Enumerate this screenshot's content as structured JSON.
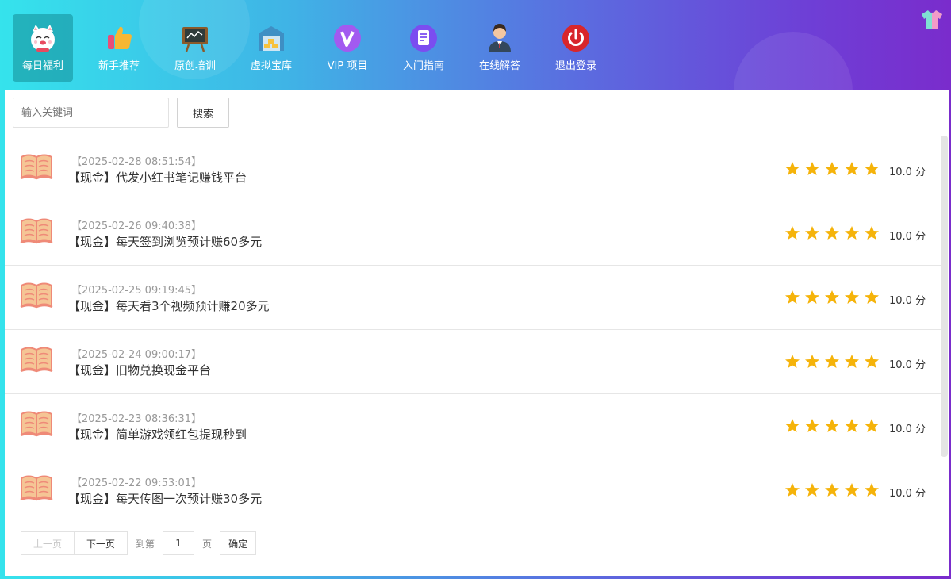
{
  "nav": {
    "items": [
      {
        "label": "每日福利",
        "icon": "lucky-cat-icon"
      },
      {
        "label": "新手推荐",
        "icon": "thumbs-up-icon"
      },
      {
        "label": "原创培训",
        "icon": "chalkboard-icon"
      },
      {
        "label": "虚拟宝库",
        "icon": "treasure-vault-icon"
      },
      {
        "label": "VIP 项目",
        "icon": "vip-icon"
      },
      {
        "label": "入门指南",
        "icon": "document-icon"
      },
      {
        "label": "在线解答",
        "icon": "support-agent-icon"
      },
      {
        "label": "退出登录",
        "icon": "power-icon"
      }
    ],
    "active_index": 0
  },
  "search": {
    "placeholder": "输入关键词",
    "button_label": "搜索"
  },
  "list": {
    "items": [
      {
        "date": "【2025-02-28 08:51:54】",
        "title": "【现金】代发小红书笔记赚钱平台",
        "rating": 5,
        "score": "10.0 分"
      },
      {
        "date": "【2025-02-26 09:40:38】",
        "title": "【现金】每天签到浏览预计赚60多元",
        "rating": 5,
        "score": "10.0 分"
      },
      {
        "date": "【2025-02-25 09:19:45】",
        "title": "【现金】每天看3个视频预计赚20多元",
        "rating": 5,
        "score": "10.0 分"
      },
      {
        "date": "【2025-02-24 09:00:17】",
        "title": "【现金】旧物兑换现金平台",
        "rating": 5,
        "score": "10.0 分"
      },
      {
        "date": "【2025-02-23 08:36:31】",
        "title": "【现金】简单游戏领红包提现秒到",
        "rating": 5,
        "score": "10.0 分"
      },
      {
        "date": "【2025-02-22 09:53:01】",
        "title": "【现金】每天传图一次预计赚30多元",
        "rating": 5,
        "score": "10.0 分"
      }
    ]
  },
  "pager": {
    "prev_label": "上一页",
    "next_label": "下一页",
    "goto_prefix": "到第",
    "page_value": "1",
    "goto_suffix": "页",
    "confirm_label": "确定"
  },
  "colors": {
    "star": "#f5b30a",
    "book": "#f28b7a",
    "active_nav": "#1d9aa0"
  }
}
